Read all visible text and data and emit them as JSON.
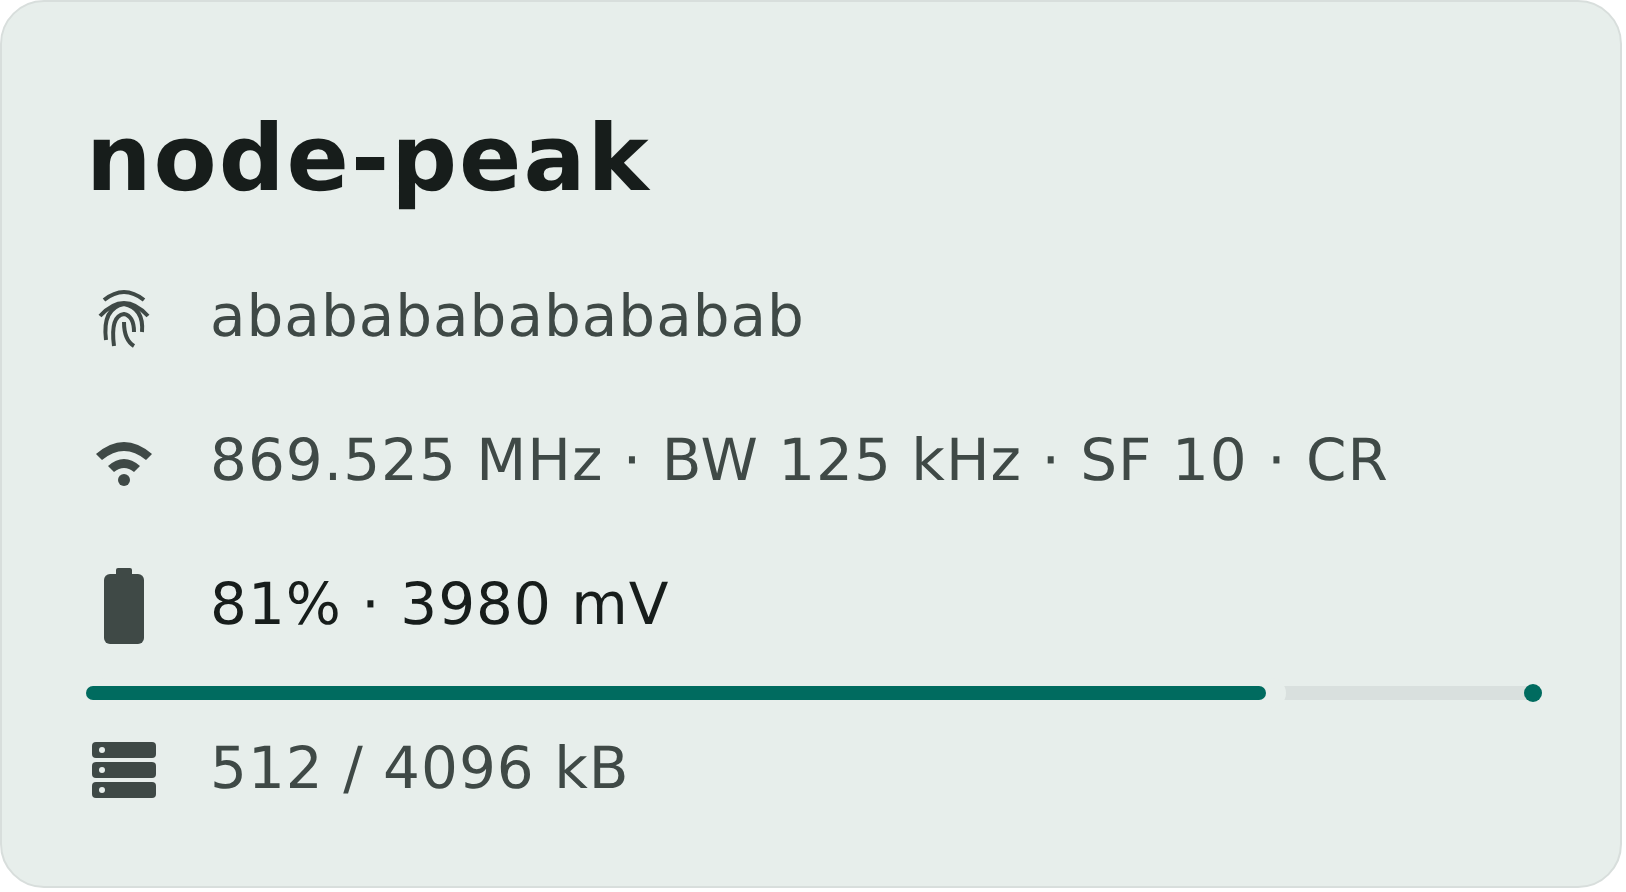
{
  "title": "node-peak",
  "rows": [
    {
      "kind": "fingerprint",
      "text": "abababababababab"
    },
    {
      "kind": "radio",
      "text": "869.525 MHz · BW 125 kHz · SF 10 · CR"
    },
    {
      "kind": "battery",
      "text": "81% · 3980 mV",
      "level": 0.81
    },
    {
      "kind": "storage",
      "text": "512 / 4096 kB"
    }
  ]
}
